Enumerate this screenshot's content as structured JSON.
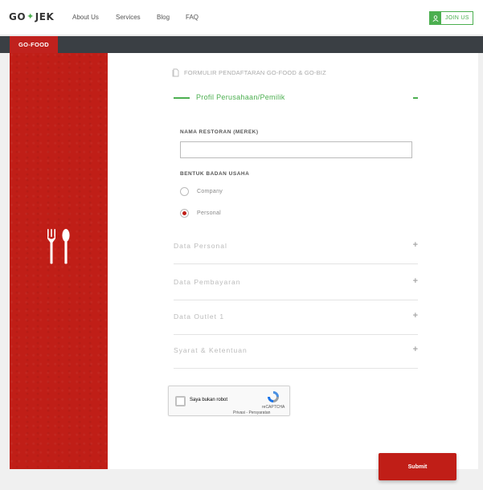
{
  "brand": {
    "logo_left": "GO",
    "logo_right": "JEK",
    "logo_icon": "scooter-icon"
  },
  "nav": {
    "items": [
      "About Us",
      "Services",
      "Blog",
      "FAQ"
    ],
    "join_label": "JOIN US",
    "join_icon": "user-icon"
  },
  "tabs": {
    "active": "GO-FOOD"
  },
  "form": {
    "title": "FORMULIR PENDAFTARAN GO-FOOD & GO-BIZ",
    "title_icon": "document-icon",
    "open_section": "Profil Perusahaan/Pemilik",
    "restaurant_label": "NAMA RESTORAN (MEREK)",
    "restaurant_value": "",
    "entity_label": "BENTUK BADAN USAHA",
    "entity_options": [
      "Company",
      "Personal"
    ],
    "entity_selected": "Personal",
    "sections": [
      "Data Personal",
      "Data Pembayaran",
      "Data Outlet 1",
      "Syarat & Ketentuan"
    ]
  },
  "captcha": {
    "label": "Saya bukan robot",
    "brand": "reCAPTCHA",
    "links": "Privasi - Persyaratan"
  },
  "submit_label": "Submit",
  "colors": {
    "primary_red": "#c01e17",
    "accent_green": "#4caf50",
    "dark_bar": "#3a3f44"
  },
  "icons": {
    "panel_icon": "fork-spoon-icon"
  }
}
